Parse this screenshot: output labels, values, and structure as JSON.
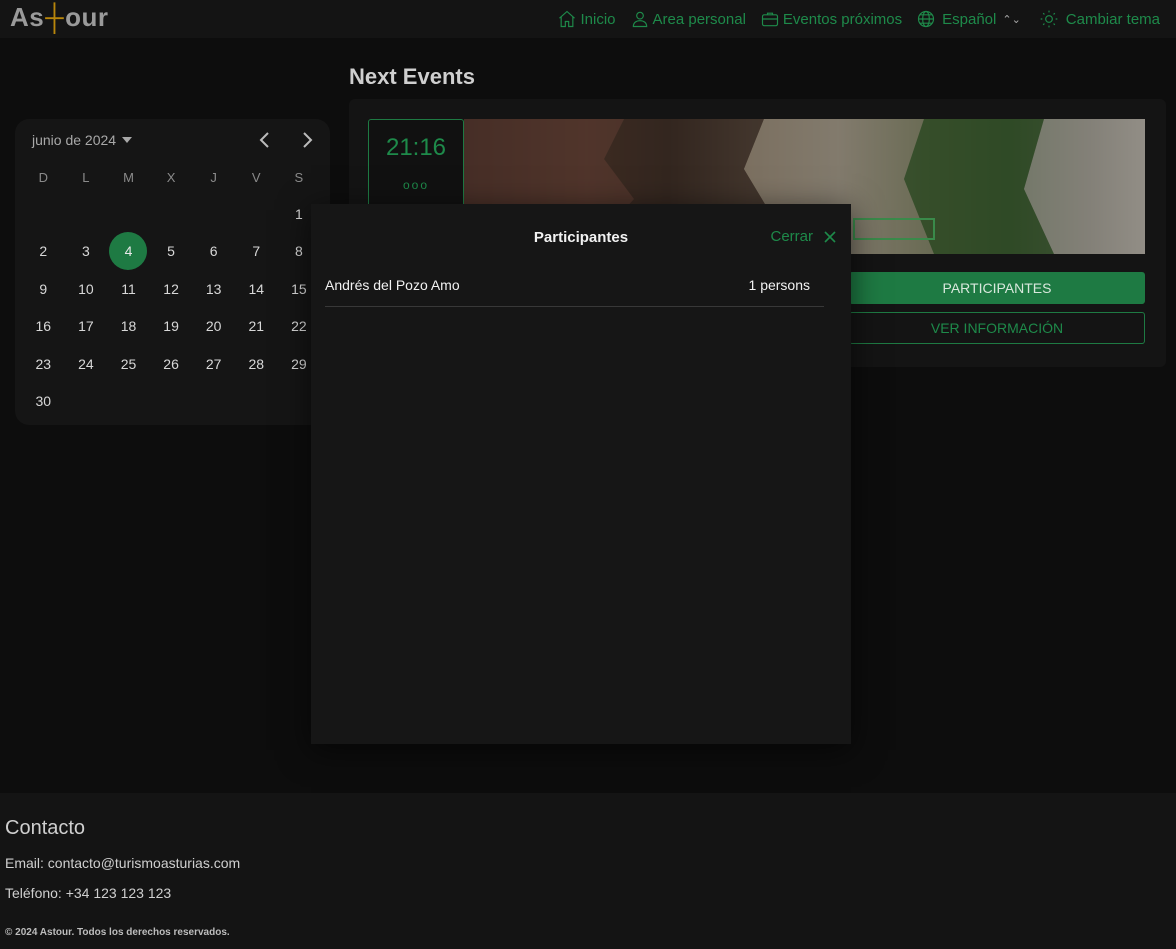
{
  "header": {
    "logo_pre": "As",
    "logo_mark": "┼",
    "logo_post": "our",
    "nav": {
      "home": "Inicio",
      "personal": "Area personal",
      "events": "Eventos próximos",
      "language": "Español",
      "theme": "Cambiar tema"
    }
  },
  "main": {
    "title": "Next Events"
  },
  "calendar": {
    "month_label": "junio de 2024",
    "weekdays": [
      "D",
      "L",
      "M",
      "X",
      "J",
      "V",
      "S"
    ],
    "selected_day": 4
  },
  "event": {
    "time": "21:16",
    "more": "ooo",
    "participants_button": "PARTICIPANTES",
    "info_button": "VER INFORMACIÓN"
  },
  "modal": {
    "title": "Participantes",
    "close_label": "Cerrar",
    "participants": [
      {
        "name": "Andrés del Pozo Amo",
        "count": "1 persons"
      }
    ]
  },
  "footer": {
    "title": "Contacto",
    "email": "Email: contacto@turismoasturias.com",
    "phone": "Teléfono: +34 123 123 123",
    "copyright": "© 2024 Astour. Todos los derechos reservados."
  },
  "colors": {
    "accent": "#1e7a43",
    "accent_text": "#1e8a4a",
    "background": "#0d0d0d",
    "panel": "#141414"
  }
}
